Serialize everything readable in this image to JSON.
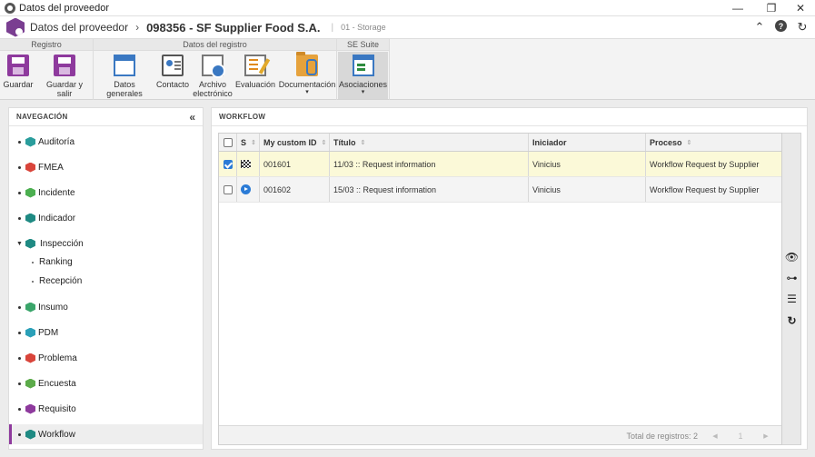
{
  "window": {
    "title": "Datos del proveedor",
    "controls": {
      "minimize": "—",
      "restore": "❐",
      "close": "✕"
    }
  },
  "header": {
    "breadcrumb": "Datos del proveedor",
    "separator": "›",
    "title": "098356 - SF Supplier Food S.A.",
    "pipe": "|",
    "subtitle": "01 - Storage",
    "icons": {
      "collapse": "⌃",
      "help": "?",
      "refresh": "↻"
    }
  },
  "ribbon": {
    "groups": [
      {
        "title": "Registro"
      },
      {
        "title": "Datos del registro"
      },
      {
        "title": "SE Suite"
      }
    ],
    "buttons": {
      "guardar": "Guardar",
      "guardar_salir": "Guardar y salir",
      "datos_generales": "Datos generales",
      "contacto": "Contacto",
      "archivo_line1": "Archivo",
      "archivo_line2": "electrónico",
      "evaluacion": "Evaluación",
      "documentacion": "Documentación",
      "asociaciones": "Asociaciones",
      "caret": "▾"
    }
  },
  "nav": {
    "title": "NAVEGACIÓN",
    "collapse": "«",
    "items": [
      {
        "label": "Auditoría",
        "color": "#2a9d9c"
      },
      {
        "label": "FMEA",
        "color": "#d9453b"
      },
      {
        "label": "Incidente",
        "color": "#4caf50"
      },
      {
        "label": "Indicador",
        "color": "#1f8a83"
      },
      {
        "label": "Inspección",
        "color": "#1f8a83",
        "expanded": "▼"
      },
      {
        "label": "Insumo",
        "color": "#3aa56a"
      },
      {
        "label": "PDM",
        "color": "#2ba0b8"
      },
      {
        "label": "Problema",
        "color": "#d9453b"
      },
      {
        "label": "Encuesta",
        "color": "#5cab4a"
      },
      {
        "label": "Requisito",
        "color": "#8e3a9d"
      },
      {
        "label": "Workflow",
        "color": "#1f8a83",
        "selected": "true"
      }
    ],
    "subitems": [
      {
        "label": "Ranking"
      },
      {
        "label": "Recepción"
      }
    ]
  },
  "workflow": {
    "title": "WORKFLOW",
    "columns": {
      "s": "S",
      "custom_id": "My custom ID",
      "titulo": "Título",
      "iniciador": "Iniciador",
      "proceso": "Proceso",
      "sort": "⇕"
    },
    "rows": [
      {
        "checked": "true",
        "status_icon": "flag-icon",
        "id": "001601",
        "titulo": "11/03 :: Request information",
        "iniciador": "Vinicius",
        "proceso": "Workflow Request by Supplier"
      },
      {
        "checked": "false",
        "status_icon": "play-icon",
        "id": "001602",
        "titulo": "15/03 :: Request information",
        "iniciador": "Vinicius",
        "proceso": "Workflow Request by Supplier"
      }
    ],
    "footer": {
      "total": "Total de registros: 2",
      "prev": "◀",
      "page": "1",
      "next": "▶"
    },
    "tools": {
      "view": "👁",
      "tree": "⊶",
      "list": "☰",
      "reload": "↻"
    }
  },
  "colors": {
    "accent": "#8e3a9d",
    "selected_row": "#fbf9d8",
    "checkbox": "#2b7bd6"
  }
}
